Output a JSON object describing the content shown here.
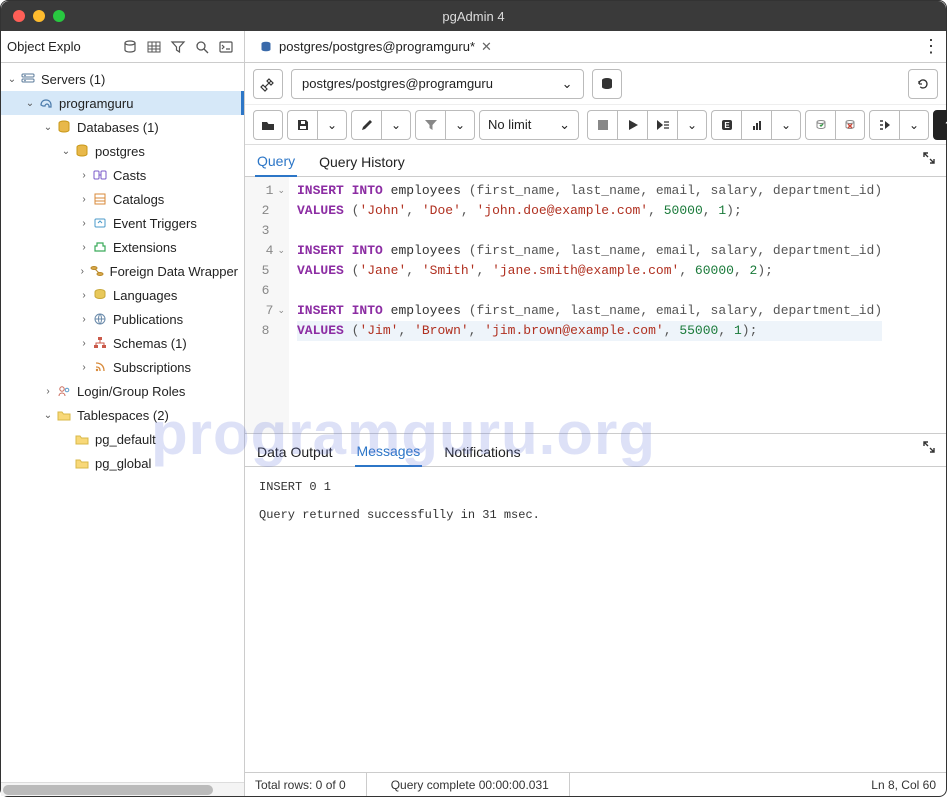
{
  "window": {
    "title": "pgAdmin 4"
  },
  "sidebar": {
    "title": "Object Explo",
    "tree": {
      "servers": "Servers (1)",
      "server_name": "programguru",
      "databases": "Databases (1)",
      "db_name": "postgres",
      "casts": "Casts",
      "catalogs": "Catalogs",
      "event_triggers": "Event Triggers",
      "extensions": "Extensions",
      "fdw": "Foreign Data Wrapper",
      "languages": "Languages",
      "publications": "Publications",
      "schemas": "Schemas (1)",
      "subscriptions": "Subscriptions",
      "login_roles": "Login/Group Roles",
      "tablespaces": "Tablespaces (2)",
      "ts1": "pg_default",
      "ts2": "pg_global"
    }
  },
  "tab": {
    "label": "postgres/postgres@programguru*"
  },
  "connection": {
    "label": "postgres/postgres@programguru"
  },
  "toolbar": {
    "limit": "No limit"
  },
  "query_tabs": {
    "query": "Query",
    "history": "Query History"
  },
  "result_tabs": {
    "data": "Data Output",
    "messages": "Messages",
    "notifications": "Notifications"
  },
  "editor": {
    "lines": {
      "1": {
        "kw1": "INSERT",
        "kw2": "INTO",
        "ident": "employees",
        "cols": "(first_name, last_name, email, salary, department_id)"
      },
      "2": {
        "kw": "VALUES",
        "v1": "'John'",
        "v2": "'Doe'",
        "v3": "'john.doe@example.com'",
        "n1": "50000",
        "n2": "1"
      },
      "4": {
        "kw1": "INSERT",
        "kw2": "INTO",
        "ident": "employees",
        "cols": "(first_name, last_name, email, salary, department_id)"
      },
      "5": {
        "kw": "VALUES",
        "v1": "'Jane'",
        "v2": "'Smith'",
        "v3": "'jane.smith@example.com'",
        "n1": "60000",
        "n2": "2"
      },
      "7": {
        "kw1": "INSERT",
        "kw2": "INTO",
        "ident": "employees",
        "cols": "(first_name, last_name, email, salary, department_id)"
      },
      "8": {
        "kw": "VALUES",
        "v1": "'Jim'",
        "v2": "'Brown'",
        "v3": "'jim.brown@example.com'",
        "n1": "55000",
        "n2": "1"
      }
    }
  },
  "messages": {
    "line1": "INSERT 0 1",
    "line2": "Query returned successfully in 31 msec."
  },
  "status": {
    "rows": "Total rows: 0 of 0",
    "complete": "Query complete 00:00:00.031",
    "pos": "Ln 8, Col 60"
  },
  "watermark": "programguru.org"
}
